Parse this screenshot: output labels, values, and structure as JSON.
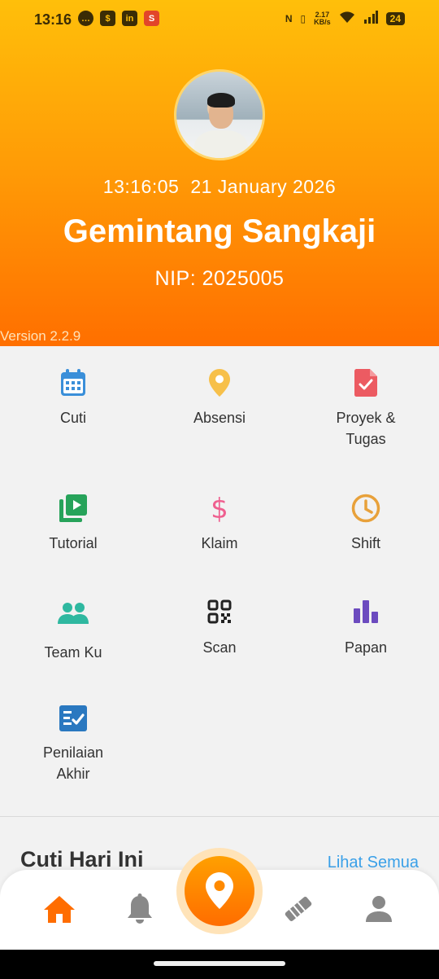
{
  "status_bar": {
    "time": "13:16",
    "left_icons": [
      "message-icon",
      "shop-icon",
      "linkedin-icon",
      "shopee-icon"
    ],
    "speed_value": "2.17",
    "speed_unit": "KB/s",
    "battery": "24"
  },
  "profile": {
    "time": "13:16:05",
    "date": "21 January 2026",
    "name": "Gemintang Sangkaji",
    "nip": "NIP: 2025005",
    "version": "Version 2.2.9"
  },
  "menu": {
    "items": [
      {
        "label": "Cuti",
        "icon": "calendar-icon",
        "color": "#3a8fd9"
      },
      {
        "label": "Absensi",
        "icon": "location-pin-icon",
        "color": "#f7c04a"
      },
      {
        "label": "Proyek &\nTugas",
        "icon": "document-check-icon",
        "color": "#ec5b62"
      },
      {
        "label": "Tutorial",
        "icon": "video-library-icon",
        "color": "#27a35a"
      },
      {
        "label": "Klaim",
        "icon": "dollar-icon",
        "color": "#ef5f8f"
      },
      {
        "label": "Shift",
        "icon": "clock-icon",
        "color": "#e8a13a"
      },
      {
        "label": "Team Ku",
        "icon": "group-icon",
        "color": "#2fb8a0"
      },
      {
        "label": "Scan",
        "icon": "qr-code-icon",
        "color": "#333333"
      },
      {
        "label": "Papan",
        "icon": "bar-chart-icon",
        "color": "#6c4bbf"
      },
      {
        "label": "Penilaian\nAkhir",
        "icon": "checklist-icon",
        "color": "#2a78c0"
      }
    ]
  },
  "section": {
    "title": "Cuti Hari Ini",
    "link": "Lihat Semua"
  },
  "bottom_nav": {
    "items": [
      "home-icon",
      "bell-icon",
      "location-pin-icon",
      "handshake-icon",
      "person-icon"
    ],
    "active_color": "#ff6d00",
    "inactive_color": "#888888"
  },
  "colors": {
    "header_top": "#ffbf0a",
    "header_bottom": "#ff6f00",
    "link": "#3aa0e8"
  }
}
